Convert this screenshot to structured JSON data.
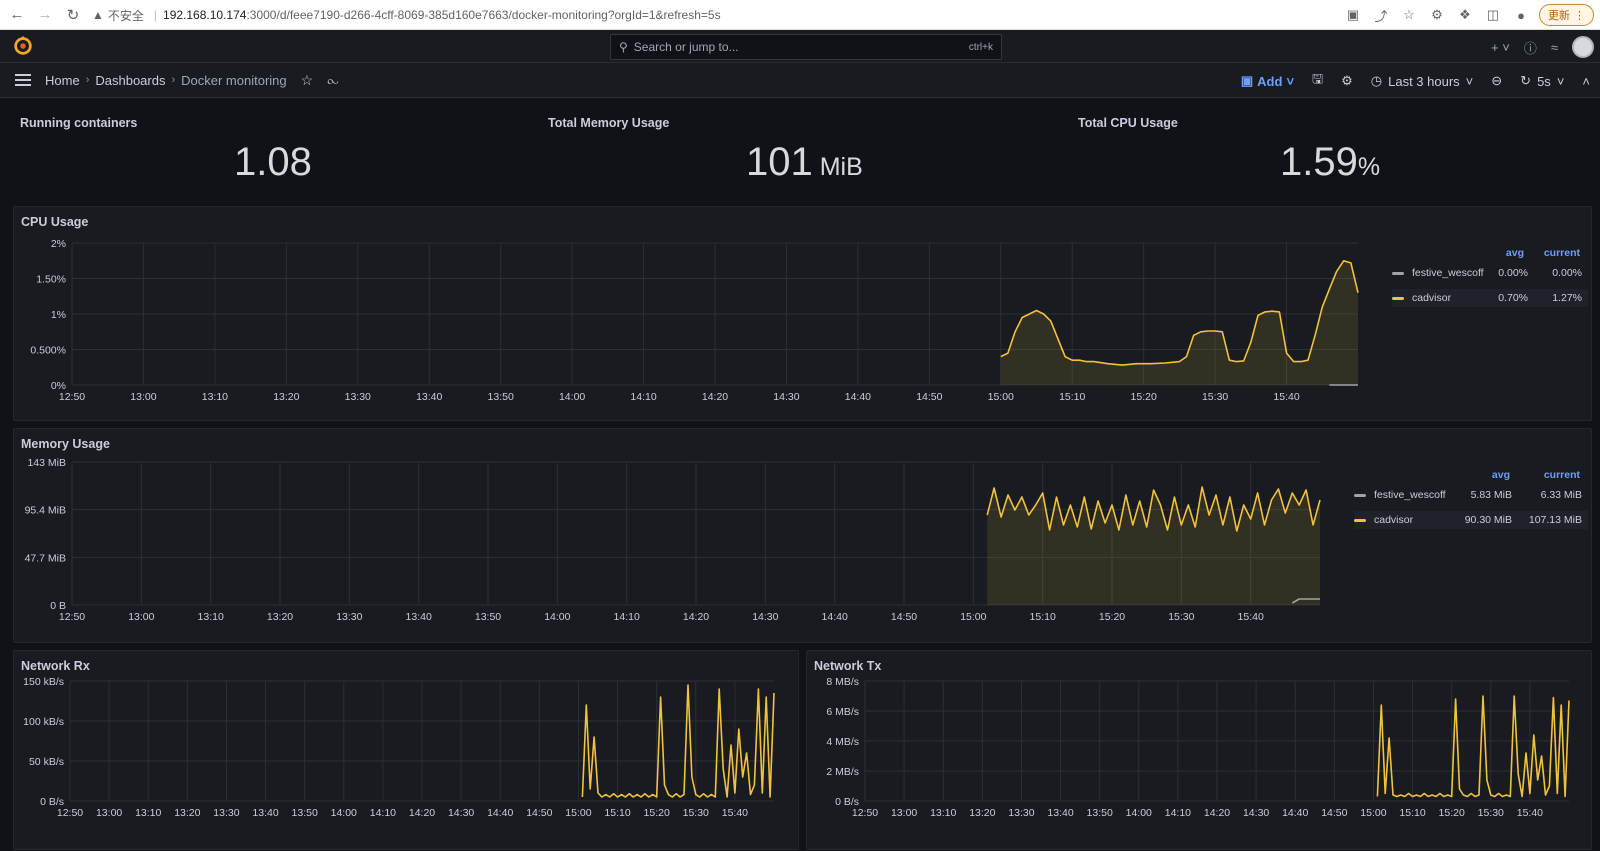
{
  "browser": {
    "security_label": "不安全",
    "url_host": "192.168.10.174",
    "url_path": ":3000/d/feee7190-d266-4cff-8069-385d160e7663/docker-monitoring?orgId=1&refresh=5s",
    "update_label": "更新"
  },
  "topbar": {
    "search_placeholder": "Search or jump to...",
    "search_shortcut": "ctrl+k"
  },
  "breadcrumb": {
    "home": "Home",
    "dashboards": "Dashboards",
    "current": "Docker monitoring"
  },
  "toolbar": {
    "add_label": "Add",
    "time_range": "Last 3 hours",
    "refresh_interval": "5s"
  },
  "stats": [
    {
      "title": "Running containers",
      "value": "1.08",
      "unit": ""
    },
    {
      "title": "Total Memory Usage",
      "value": "101",
      "unit": " MiB"
    },
    {
      "title": "Total CPU Usage",
      "value": "1.59",
      "unit": "%"
    }
  ],
  "panels": {
    "cpu": {
      "title": "CPU Usage",
      "legend_headers": [
        "avg",
        "current"
      ],
      "legend": [
        {
          "name": "festive_wescoff",
          "avg": "0.00%",
          "current": "0.00%",
          "color": "#a3a3a3"
        },
        {
          "name": "cadvisor",
          "avg": "0.70%",
          "current": "1.27%",
          "color": "#f2c23e"
        }
      ]
    },
    "memory": {
      "title": "Memory Usage",
      "legend_headers": [
        "avg",
        "current"
      ],
      "legend": [
        {
          "name": "festive_wescoff",
          "avg": "5.83 MiB",
          "current": "6.33 MiB",
          "color": "#a3a3a3"
        },
        {
          "name": "cadvisor",
          "avg": "90.30 MiB",
          "current": "107.13 MiB",
          "color": "#f2c23e"
        }
      ]
    },
    "rx": {
      "title": "Network Rx"
    },
    "tx": {
      "title": "Network Tx"
    }
  },
  "chart_data": [
    {
      "type": "area",
      "title": "CPU Usage",
      "x_ticks": [
        "12:50",
        "13:00",
        "13:10",
        "13:20",
        "13:30",
        "13:40",
        "13:50",
        "14:00",
        "14:10",
        "14:20",
        "14:30",
        "14:40",
        "14:50",
        "15:00",
        "15:10",
        "15:20",
        "15:30",
        "15:40"
      ],
      "y_ticks": [
        "0%",
        "0.500%",
        "1%",
        "1.50%",
        "2%"
      ],
      "ylim": [
        0,
        2
      ],
      "xlim_minutes": [
        0,
        170
      ],
      "series": [
        {
          "name": "cadvisor",
          "color": "#f2c23e",
          "x": [
            130,
            131,
            132,
            133,
            134,
            135,
            136,
            137,
            138,
            139,
            140,
            141,
            142,
            143,
            145,
            147,
            149,
            151,
            153,
            155,
            156,
            157,
            158,
            159,
            160,
            161,
            162,
            163,
            164,
            165,
            166,
            167,
            168,
            169,
            170,
            171,
            172,
            173,
            174,
            175,
            176,
            177,
            178,
            179,
            180
          ],
          "y": [
            0.4,
            0.45,
            0.75,
            0.95,
            1.0,
            1.05,
            1.0,
            0.9,
            0.65,
            0.4,
            0.35,
            0.35,
            0.33,
            0.33,
            0.3,
            0.28,
            0.3,
            0.3,
            0.31,
            0.33,
            0.4,
            0.7,
            0.75,
            0.76,
            0.76,
            0.75,
            0.35,
            0.33,
            0.34,
            0.6,
            0.98,
            1.03,
            1.04,
            1.03,
            0.45,
            0.33,
            0.33,
            0.35,
            0.7,
            1.1,
            1.35,
            1.6,
            1.75,
            1.72,
            1.3
          ]
        },
        {
          "name": "festive_wescoff",
          "color": "#a3a3a3",
          "x": [
            176,
            180
          ],
          "y": [
            0.0,
            0.0
          ]
        }
      ]
    },
    {
      "type": "area",
      "title": "Memory Usage",
      "x_ticks": [
        "12:50",
        "13:00",
        "13:10",
        "13:20",
        "13:30",
        "13:40",
        "13:50",
        "14:00",
        "14:10",
        "14:20",
        "14:30",
        "14:40",
        "14:50",
        "15:00",
        "15:10",
        "15:20",
        "15:30",
        "15:40"
      ],
      "y_ticks": [
        "0 B",
        "47.7 MiB",
        "95.4 MiB",
        "143 MiB"
      ],
      "ylim": [
        0,
        143
      ],
      "series": [
        {
          "name": "cadvisor",
          "color": "#f2c23e",
          "x": [
            132,
            133,
            134,
            135,
            136,
            137,
            138,
            139,
            140,
            141,
            142,
            143,
            144,
            145,
            146,
            147,
            148,
            149,
            150,
            151,
            152,
            153,
            154,
            155,
            156,
            157,
            158,
            159,
            160,
            161,
            162,
            163,
            164,
            165,
            166,
            167,
            168,
            169,
            170,
            171,
            172,
            173,
            174,
            175,
            176,
            177,
            178,
            179,
            180
          ],
          "y": [
            90,
            117,
            88,
            110,
            95,
            108,
            90,
            100,
            112,
            75,
            108,
            80,
            100,
            78,
            108,
            76,
            104,
            82,
            100,
            75,
            110,
            80,
            104,
            78,
            115,
            100,
            75,
            108,
            80,
            100,
            78,
            118,
            90,
            110,
            80,
            108,
            74,
            100,
            86,
            112,
            80,
            105,
            116,
            92,
            112,
            100,
            115,
            80,
            105
          ]
        },
        {
          "name": "festive_wescoff",
          "color": "#a3a3a3",
          "x": [
            176,
            177,
            180
          ],
          "y": [
            2,
            6,
            6
          ]
        }
      ]
    },
    {
      "type": "line",
      "title": "Network Rx",
      "x_ticks": [
        "12:50",
        "13:00",
        "13:10",
        "13:20",
        "13:30",
        "13:40",
        "13:50",
        "14:00",
        "14:10",
        "14:20",
        "14:30",
        "14:40",
        "14:50",
        "15:00",
        "15:10",
        "15:20",
        "15:30",
        "15:40"
      ],
      "y_ticks": [
        "0 B/s",
        "50 kB/s",
        "100 kB/s",
        "150 kB/s"
      ],
      "ylim": [
        0,
        150
      ],
      "series": [
        {
          "name": "cadvisor",
          "color": "#f2c23e",
          "x": [
            131,
            132,
            133,
            134,
            135,
            136,
            137,
            138,
            139,
            140,
            141,
            142,
            143,
            144,
            145,
            146,
            147,
            148,
            149,
            150,
            151,
            152,
            153,
            154,
            155,
            156,
            157,
            158,
            159,
            160,
            161,
            162,
            163,
            164,
            165,
            166,
            167,
            168,
            169,
            170,
            171,
            172,
            173,
            174,
            175,
            176,
            177,
            178,
            179,
            180
          ],
          "y": [
            5,
            120,
            15,
            80,
            10,
            5,
            8,
            5,
            9,
            5,
            8,
            5,
            9,
            5,
            8,
            5,
            9,
            5,
            8,
            5,
            130,
            20,
            8,
            5,
            9,
            5,
            8,
            145,
            30,
            8,
            5,
            9,
            5,
            8,
            5,
            140,
            40,
            5,
            70,
            10,
            90,
            30,
            60,
            8,
            20,
            140,
            10,
            130,
            5,
            135
          ]
        }
      ]
    },
    {
      "type": "line",
      "title": "Network Tx",
      "x_ticks": [
        "12:50",
        "13:00",
        "13:10",
        "13:20",
        "13:30",
        "13:40",
        "13:50",
        "14:00",
        "14:10",
        "14:20",
        "14:30",
        "14:40",
        "14:50",
        "15:00",
        "15:10",
        "15:20",
        "15:30",
        "15:40"
      ],
      "y_ticks": [
        "0 B/s",
        "2 MB/s",
        "4 MB/s",
        "6 MB/s",
        "8 MB/s"
      ],
      "ylim": [
        0,
        8
      ],
      "series": [
        {
          "name": "cadvisor",
          "color": "#f2c23e",
          "x": [
            131,
            132,
            133,
            134,
            135,
            136,
            137,
            138,
            139,
            140,
            141,
            142,
            143,
            144,
            145,
            146,
            147,
            148,
            149,
            150,
            151,
            152,
            153,
            154,
            155,
            156,
            157,
            158,
            159,
            160,
            161,
            162,
            163,
            164,
            165,
            166,
            167,
            168,
            169,
            170,
            171,
            172,
            173,
            174,
            175,
            176,
            177,
            178,
            179,
            180
          ],
          "y": [
            0.3,
            6.4,
            0.5,
            4.2,
            0.4,
            0.3,
            0.4,
            0.3,
            0.5,
            0.3,
            0.4,
            0.3,
            0.5,
            0.3,
            0.4,
            0.3,
            0.5,
            0.3,
            0.4,
            0.3,
            6.8,
            0.8,
            0.4,
            0.3,
            0.5,
            0.3,
            0.4,
            7.0,
            1.4,
            0.4,
            0.3,
            0.5,
            0.3,
            0.4,
            0.3,
            7.0,
            1.8,
            0.3,
            3.2,
            0.5,
            4.4,
            1.4,
            3.0,
            0.4,
            1.0,
            6.9,
            0.5,
            6.4,
            0.3,
            6.7
          ]
        }
      ]
    }
  ]
}
